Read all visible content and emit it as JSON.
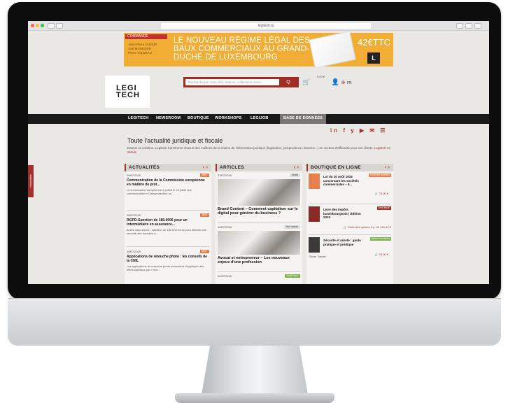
{
  "browser": {
    "url": "legitech.lu",
    "traffic_lights": [
      "#ff5f57",
      "#febc2e",
      "#28c840"
    ]
  },
  "banner": {
    "tag": "COMMANDE",
    "authors": [
      "Jean-Pierre DUMUR",
      "Joël MONEGER",
      "Pierre VALDEAU"
    ],
    "headline": "LE NOUVEAU RÉGIME LÉGAL DES BAUX COMMERCIAUX AU GRAND-DUCHÉ DE LUXEMBOURG",
    "price": "42€TTC",
    "logo_letter": "L"
  },
  "header": {
    "logo": "LEGI\nTECH",
    "search_placeholder": "Recherche par mots-clés, auteurs, collections, livres...",
    "search_button": "Q",
    "cart_amount": "0,00 €",
    "lang": "FR"
  },
  "nav": {
    "items": [
      "LEGITECH",
      "NEWSROOM",
      "BOUTIQUE",
      "WORKSHOPS",
      "LEGIJOB",
      "BASE DE DONNÉES"
    ],
    "active": "BASE DE DONNÉES"
  },
  "social": [
    "in",
    "f",
    "y",
    "▶",
    "✉",
    "☰"
  ],
  "intro": {
    "title": "Toute l'actualité juridique et fiscale",
    "text": "Depuis sa création, Legitech transforme chacun des maillons de la chaîne de l'information juridique (législation, jurisprudence, doctrine...) en vecteur d'efficacité pour ses clients.",
    "link": "Legitech en détails"
  },
  "newsletter": "Newsletter",
  "columns": {
    "actualites": {
      "title": "ACTUALITÉS",
      "items": [
        {
          "date": "26/07/2019",
          "badge": "BNT",
          "title": "Communication de la Commission européenne en matière de prot...",
          "text": "La Commission européenne a publié le 25 juillet une communication « Data protection rul..."
        },
        {
          "date": "26/07/2019",
          "badge": "BNT",
          "title": "RGPD-Sanction de 180.000€ pour un intermédiaire en assurance...",
          "text": "Active assurances : sanction de 180 000 euros pour atteinte à la sécurité des données d..."
        },
        {
          "date": "25/07/2019",
          "badge": "BNT",
          "title": "Applications de retouche photo : les conseils de la CNIL",
          "text": "Les applications de retouche photo permettent d'appliquer des effets spéciaux par « mor..."
        }
      ]
    },
    "articles": {
      "title": "ARTICLES",
      "items": [
        {
          "date": "23/07/2019",
          "cat": "Droits",
          "title": "Brand Content – Comment capitaliser sur le digital pour générer du business ?"
        },
        {
          "date": "19/07/2019",
          "cat": "Non classé",
          "title": "Avocat et entrepreneur – Les nouveaux enjeux d'une profession"
        },
        {
          "date": "04/07/2019",
          "cat": "Droit fiscal",
          "title": ""
        }
      ]
    },
    "boutique": {
      "title": "BOUTIQUE EN LIGNE",
      "items": [
        {
          "tag": "Droit des sociétés",
          "title": "Loi du 10 août 1915 concernant les sociétés commerciales – 6...",
          "price": "75,00 €",
          "color": "#e8804d"
        },
        {
          "tag": "Droit fiscal",
          "title": "Livre des impôts luxembourgeois | Édition 2019",
          "price": "Choix des options  À p. de 181,42 €",
          "color": "#a0302a"
        },
        {
          "tag": "Autres domaines",
          "title": "Sécurité et sûreté : guide pratique et juridique",
          "author": "Olivier Vasseil",
          "price": "29,00 €",
          "color": "#7fb24a"
        }
      ]
    }
  }
}
